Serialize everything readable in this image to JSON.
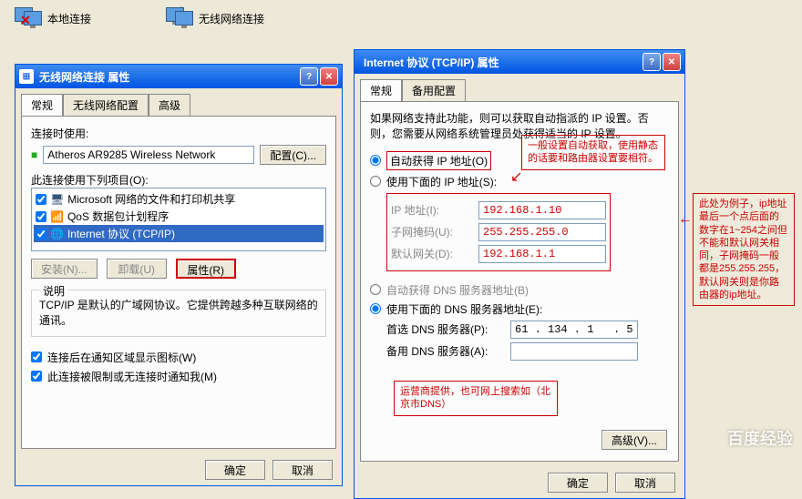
{
  "desktop": {
    "local_conn": "本地连接",
    "wireless_conn": "无线网络连接"
  },
  "dlg1": {
    "title": "无线网络连接 属性",
    "tabs": [
      "常规",
      "无线网络配置",
      "高级"
    ],
    "connect_using": "连接时使用:",
    "adapter": "Atheros AR9285 Wireless Network",
    "configure_btn": "配置(C)...",
    "items_label": "此连接使用下列项目(O):",
    "items": [
      "Microsoft 网络的文件和打印机共享",
      "QoS 数据包计划程序",
      "Internet 协议 (TCP/IP)"
    ],
    "install_btn": "安装(N)...",
    "uninstall_btn": "卸载(U)",
    "props_btn": "属性(R)",
    "desc_label": "说明",
    "desc_text": "TCP/IP 是默认的广域网协议。它提供跨越多种互联网络的通讯。",
    "show_icon": "连接后在通知区域显示图标(W)",
    "notify_limited": "此连接被限制或无连接时通知我(M)",
    "ok": "确定",
    "cancel": "取消"
  },
  "dlg2": {
    "title": "Internet 协议 (TCP/IP) 属性",
    "tabs": [
      "常规",
      "备用配置"
    ],
    "intro": "如果网络支持此功能，则可以获取自动指派的 IP 设置。否则，您需要从网络系统管理员处获得适当的 IP 设置。",
    "auto_ip": "自动获得 IP 地址(O)",
    "use_ip": "使用下面的 IP 地址(S):",
    "ip_label": "IP 地址(I):",
    "ip_value": "192.168.1.10",
    "mask_label": "子网掩码(U):",
    "mask_value": "255.255.255.0",
    "gw_label": "默认网关(D):",
    "gw_value": "192.168.1.1",
    "auto_dns": "自动获得 DNS 服务器地址(B)",
    "use_dns": "使用下面的 DNS 服务器地址(E):",
    "dns1_label": "首选 DNS 服务器(P):",
    "dns1_value": "61 . 134 . 1   . 5",
    "dns2_label": "备用 DNS 服务器(A):",
    "dns2_value": "",
    "advanced_btn": "高级(V)...",
    "ok": "确定",
    "cancel": "取消"
  },
  "annotations": {
    "a1": "一般设置自动获取，使用静态的话要和路由器设置要相符。",
    "a2": "此处为例子，ip地址最后一个点后面的数字在1~254之间但不能和默认网关相同，子网掩码一般都是255.255.255，默认网关则是你路由器的ip地址。",
    "a3": "运营商提供，也可网上搜索如（北京市DNS）"
  },
  "watermark": "百度经验"
}
